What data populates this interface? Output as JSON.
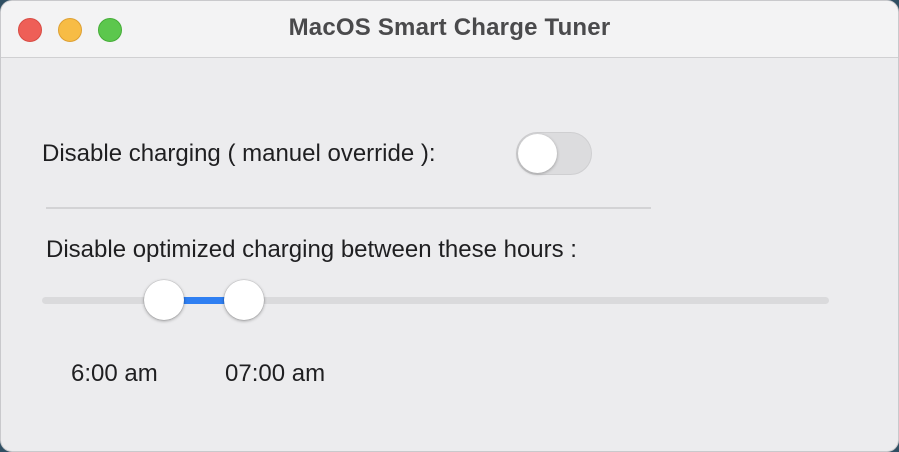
{
  "window": {
    "title": "MacOS Smart Charge Tuner"
  },
  "override": {
    "label": "Disable charging ( manuel override ):",
    "enabled": false
  },
  "schedule": {
    "label": "Disable optimized charging between these hours :",
    "slider": {
      "start_fraction": 0.155,
      "end_fraction": 0.257,
      "accent_color": "#2f7ff2"
    },
    "start_time": "6:00 am",
    "end_time": "07:00 am"
  }
}
